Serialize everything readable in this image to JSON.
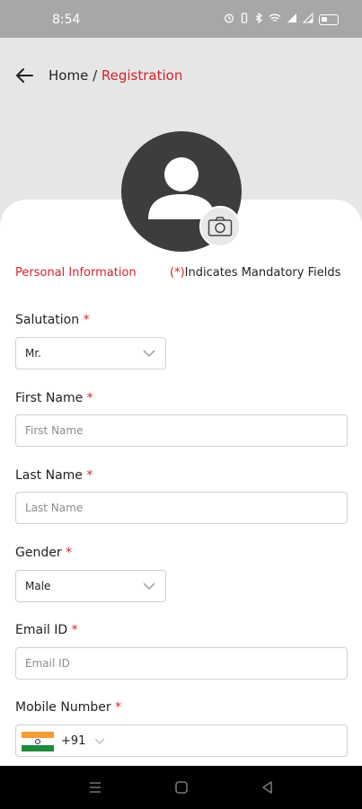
{
  "status_bar": {
    "time": "8:54",
    "icons": [
      "alarm-icon",
      "vibrate-icon",
      "bluetooth-icon",
      "wifi-icon",
      "signal-icon",
      "battery-icon"
    ]
  },
  "header": {
    "breadcrumb_home": "Home",
    "breadcrumb_separator": " / ",
    "breadcrumb_current": "Registration"
  },
  "section": {
    "title": "Personal Information",
    "mandatory_marker": "(*)",
    "mandatory_note": "Indicates Mandatory Fields"
  },
  "form": {
    "required_marker": "*",
    "salutation": {
      "label": "Salutation",
      "value": "Mr."
    },
    "first_name": {
      "label": "First Name",
      "placeholder": "First Name"
    },
    "last_name": {
      "label": "Last Name",
      "placeholder": "Last Name"
    },
    "gender": {
      "label": "Gender",
      "value": "Male"
    },
    "email": {
      "label": "Email ID",
      "placeholder": "Email ID"
    },
    "mobile": {
      "label": "Mobile Number",
      "dial_code": "+91",
      "country_flag": "india-flag-icon"
    }
  },
  "colors": {
    "accent": "#d4242b",
    "avatar_bg": "#3d3d3d",
    "page_bg": "#e6e6e6"
  }
}
